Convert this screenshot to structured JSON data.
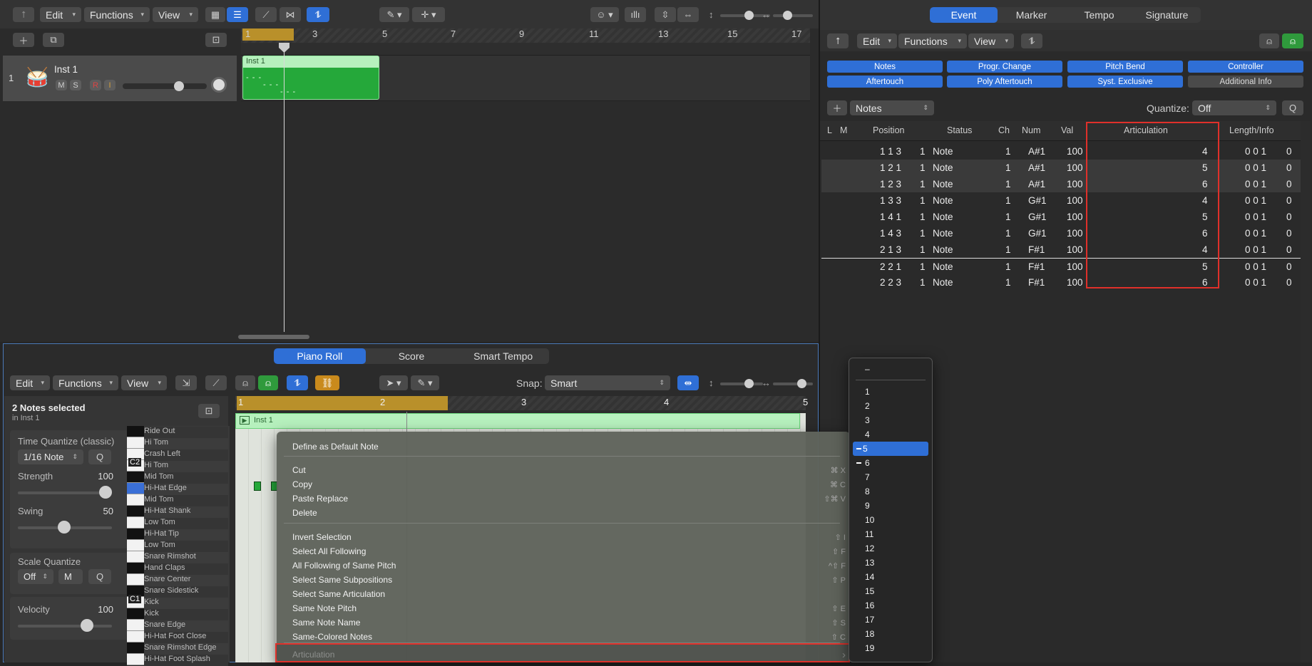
{
  "tracks_toolbar": {
    "edit": "Edit",
    "functions": "Functions",
    "view": "View"
  },
  "ruler_top": [
    "1",
    "3",
    "5",
    "7",
    "9",
    "11",
    "13",
    "15",
    "17"
  ],
  "track": {
    "number": "1",
    "name": "Inst 1",
    "mute": "M",
    "solo": "S",
    "record": "R",
    "input": "I"
  },
  "region": {
    "name": "Inst 1"
  },
  "event_tabs": [
    "Event",
    "Marker",
    "Tempo",
    "Signature"
  ],
  "event_toolbar": {
    "edit": "Edit",
    "functions": "Functions",
    "view": "View"
  },
  "filters": [
    "Notes",
    "Progr. Change",
    "Pitch Bend",
    "Controller",
    "Aftertouch",
    "Poly Aftertouch",
    "Syst. Exclusive",
    "Additional Info"
  ],
  "event_type_select": "Notes",
  "quantize": {
    "label": "Quantize:",
    "value": "Off",
    "q_button": "Q"
  },
  "list_headers": {
    "l": "L",
    "m": "M",
    "position": "Position",
    "status": "Status",
    "ch": "Ch",
    "num": "Num",
    "val": "Val",
    "articulation": "Articulation",
    "length": "Length/Info"
  },
  "events": [
    {
      "pos": "1 1 3",
      "sub": "1",
      "status": "Note",
      "ch": "1",
      "num": "A#1",
      "val": "100",
      "art": "4",
      "len": "0 0 1",
      "len2": "0"
    },
    {
      "pos": "1 2 1",
      "sub": "1",
      "status": "Note",
      "ch": "1",
      "num": "A#1",
      "val": "100",
      "art": "5",
      "len": "0 0 1",
      "len2": "0"
    },
    {
      "pos": "1 2 3",
      "sub": "1",
      "status": "Note",
      "ch": "1",
      "num": "A#1",
      "val": "100",
      "art": "6",
      "len": "0 0 1",
      "len2": "0"
    },
    {
      "pos": "1 3 3",
      "sub": "1",
      "status": "Note",
      "ch": "1",
      "num": "G#1",
      "val": "100",
      "art": "4",
      "len": "0 0 1",
      "len2": "0"
    },
    {
      "pos": "1 4 1",
      "sub": "1",
      "status": "Note",
      "ch": "1",
      "num": "G#1",
      "val": "100",
      "art": "5",
      "len": "0 0 1",
      "len2": "0"
    },
    {
      "pos": "1 4 3",
      "sub": "1",
      "status": "Note",
      "ch": "1",
      "num": "G#1",
      "val": "100",
      "art": "6",
      "len": "0 0 1",
      "len2": "0"
    },
    {
      "pos": "2 1 3",
      "sub": "1",
      "status": "Note",
      "ch": "1",
      "num": "F#1",
      "val": "100",
      "art": "4",
      "len": "0 0 1",
      "len2": "0"
    },
    {
      "pos": "2 2 1",
      "sub": "1",
      "status": "Note",
      "ch": "1",
      "num": "F#1",
      "val": "100",
      "art": "5",
      "len": "0 0 1",
      "len2": "0"
    },
    {
      "pos": "2 2 3",
      "sub": "1",
      "status": "Note",
      "ch": "1",
      "num": "F#1",
      "val": "100",
      "art": "6",
      "len": "0 0 1",
      "len2": "0"
    }
  ],
  "editor_tabs": [
    "Piano Roll",
    "Score",
    "Smart Tempo"
  ],
  "editor_toolbar": {
    "edit": "Edit",
    "functions": "Functions",
    "view": "View",
    "snap_label": "Snap:",
    "snap_value": "Smart"
  },
  "selection": {
    "title": "2 Notes selected",
    "sub": "in Inst 1"
  },
  "time_quantize": {
    "label": "Time Quantize (classic)",
    "value": "1/16 Note",
    "q": "Q",
    "strength_label": "Strength",
    "strength": "100",
    "swing_label": "Swing",
    "swing": "50"
  },
  "scale_quantize": {
    "label": "Scale Quantize",
    "value": "Off",
    "mode": "M",
    "q": "Q"
  },
  "velocity": {
    "label": "Velocity",
    "value": "100"
  },
  "ruler_editor": [
    "1",
    "2",
    "3",
    "4",
    "5"
  ],
  "editor_region": "Inst 1",
  "keys": [
    "Ride Out",
    "Hi Tom",
    "Crash Left",
    "Hi Tom",
    "Mid Tom",
    "Hi-Hat Edge",
    "Mid Tom",
    "Hi-Hat Shank",
    "Low Tom",
    "Hi-Hat Tip",
    "Low Tom",
    "Snare Rimshot",
    "Hand Claps",
    "Snare Center",
    "Snare Sidestick",
    "Kick",
    "Kick",
    "Snare Edge",
    "Hi-Hat Foot Close",
    "Snare Rimshot Edge",
    "Hi-Hat Foot Splash"
  ],
  "octave_labels": {
    "c2": "C2",
    "c1": "C1"
  },
  "context_menu": [
    {
      "label": "Define as Default Note",
      "sc": ""
    },
    {
      "label": "Cut",
      "sc": "⌘ X"
    },
    {
      "label": "Copy",
      "sc": "⌘ C"
    },
    {
      "label": "Paste Replace",
      "sc": "⇧⌘ V"
    },
    {
      "label": "Delete",
      "sc": ""
    },
    {
      "label": "Invert Selection",
      "sc": "⇧ I"
    },
    {
      "label": "Select All Following",
      "sc": "⇧ F"
    },
    {
      "label": "All Following of Same Pitch",
      "sc": "^⇧ F"
    },
    {
      "label": "Select Same Subpositions",
      "sc": "⇧ P"
    },
    {
      "label": "Select Same Articulation",
      "sc": ""
    },
    {
      "label": "Same Note Pitch",
      "sc": "⇧ E"
    },
    {
      "label": "Same Note Name",
      "sc": "⇧ S"
    },
    {
      "label": "Same-Colored Notes",
      "sc": "⇧ C"
    },
    {
      "label": "Articulation",
      "sc": "›"
    }
  ],
  "submenu": {
    "none": "–",
    "items": [
      "1",
      "2",
      "3",
      "4",
      "5",
      "6",
      "7",
      "8",
      "9",
      "10",
      "11",
      "12",
      "13",
      "14",
      "15",
      "16",
      "17",
      "18",
      "19"
    ],
    "selected": "5",
    "marked": "6"
  },
  "colors": {
    "accent": "#2f6fd6",
    "region_green": "#25a83a",
    "highlight_red": "#e0302a"
  }
}
